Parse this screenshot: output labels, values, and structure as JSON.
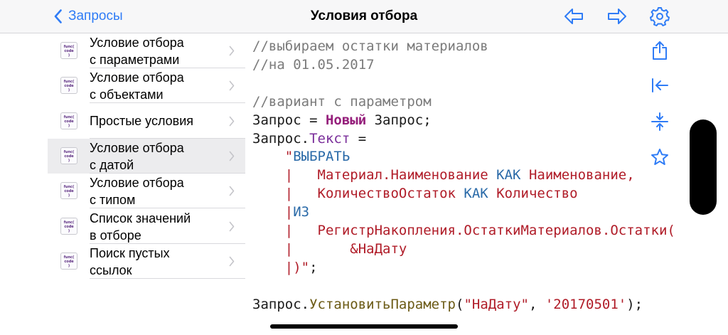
{
  "navbar": {
    "back_label": "Запросы",
    "title": "Условия отбора",
    "icons": [
      "arrow-left-icon",
      "arrow-right-icon",
      "gear-icon"
    ]
  },
  "accent_color": "#2f7cf6",
  "sidebar": {
    "items": [
      {
        "lines": [
          "Условие отбора",
          "с параметрами"
        ],
        "selected": false
      },
      {
        "lines": [
          "Условие отбора",
          "с объектами"
        ],
        "selected": false
      },
      {
        "lines": [
          "Простые условия"
        ],
        "selected": false
      },
      {
        "lines": [
          "Условие отбора",
          "с датой"
        ],
        "selected": true
      },
      {
        "lines": [
          "Условие отбора",
          "с типом"
        ],
        "selected": false
      },
      {
        "lines": [
          "Список значений",
          "в отборе"
        ],
        "selected": false
      },
      {
        "lines": [
          "Поиск пустых",
          "ссылок"
        ],
        "selected": false
      }
    ],
    "item_icon": {
      "line1": "func(",
      "line2": "code",
      "line3": ")"
    }
  },
  "code": {
    "lines": [
      [
        {
          "t": "//выбираем остатки материалов",
          "c": "comment"
        }
      ],
      [
        {
          "t": "//на 01.05.2017",
          "c": "comment"
        }
      ],
      [],
      [
        {
          "t": "//вариант с параметром",
          "c": "comment"
        }
      ],
      [
        {
          "t": "Запрос = ",
          "c": "plain"
        },
        {
          "t": "Новый",
          "c": "kw"
        },
        {
          "t": " Запрос;",
          "c": "plain"
        }
      ],
      [
        {
          "t": "Запрос.",
          "c": "plain"
        },
        {
          "t": "Текст",
          "c": "prop"
        },
        {
          "t": " =",
          "c": "plain"
        }
      ],
      [
        {
          "t": "    \"",
          "c": "str"
        },
        {
          "t": "ВЫБРАТЬ",
          "c": "qkw"
        }
      ],
      [
        {
          "t": "    |   Материал.Наименование ",
          "c": "str"
        },
        {
          "t": "КАК",
          "c": "qkw"
        },
        {
          "t": " Наименование,",
          "c": "str"
        }
      ],
      [
        {
          "t": "    |   КоличествоОстаток ",
          "c": "str"
        },
        {
          "t": "КАК",
          "c": "qkw"
        },
        {
          "t": " Количество",
          "c": "str"
        }
      ],
      [
        {
          "t": "    |",
          "c": "str"
        },
        {
          "t": "ИЗ",
          "c": "qkw"
        }
      ],
      [
        {
          "t": "    |   РегистрНакопления.ОстаткиМатериалов.Остатки(",
          "c": "str"
        }
      ],
      [
        {
          "t": "    |       &НаДату",
          "c": "str"
        }
      ],
      [
        {
          "t": "    |)\"",
          "c": "str"
        },
        {
          "t": ";",
          "c": "plain"
        }
      ],
      [],
      [
        {
          "t": "Запрос.",
          "c": "plain"
        },
        {
          "t": "УстановитьПараметр",
          "c": "func"
        },
        {
          "t": "(",
          "c": "plain"
        },
        {
          "t": "\"НаДату\"",
          "c": "str"
        },
        {
          "t": ", ",
          "c": "plain"
        },
        {
          "t": "'20170501'",
          "c": "str"
        },
        {
          "t": ");",
          "c": "plain"
        }
      ]
    ]
  },
  "side_toolbar": [
    "share-icon",
    "arrow-to-start-icon",
    "collapse-icon",
    "star-icon"
  ]
}
